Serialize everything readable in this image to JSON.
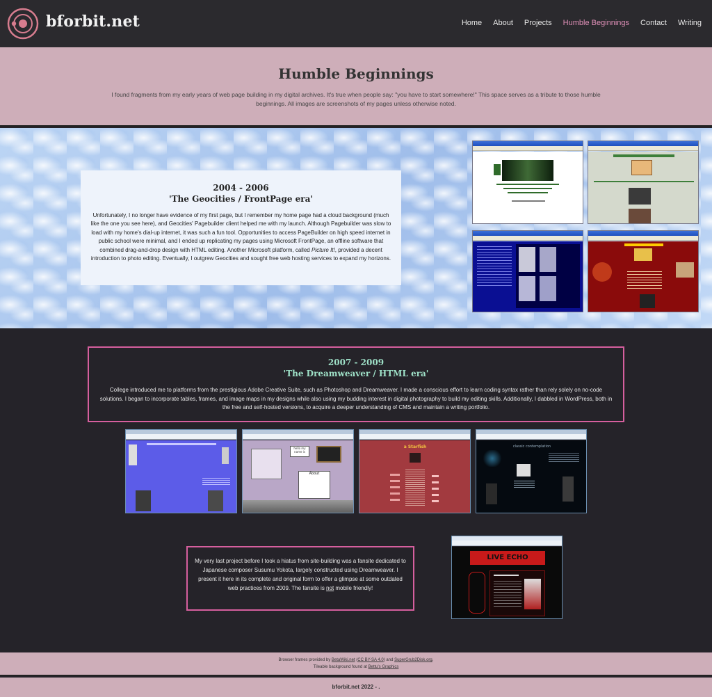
{
  "site": {
    "logo_text": "bforbit.net"
  },
  "nav": {
    "items": [
      {
        "label": "Home"
      },
      {
        "label": "About"
      },
      {
        "label": "Projects"
      },
      {
        "label": "Humble Beginnings",
        "active": true
      },
      {
        "label": "Contact"
      },
      {
        "label": "Writing"
      }
    ]
  },
  "intro": {
    "title": "Humble Beginnings",
    "text": "I found fragments from my early years of web page building in my digital archives. It's true when people say: \"you have to start somewhere!\" This space serves as a tribute to those humble beginnings. All images are screenshots of my pages unless otherwise noted."
  },
  "era1": {
    "years": "2004 - 2006",
    "subtitle": "'The Geocities / FrontPage era'",
    "text_before": "Unfortunately, I no longer have evidence of my first page, but I remember my home page had a cloud background (much like the one you see here), and Geocities' Pagebuilder client helped me with my launch. Although Pagebuilder was slow to load with my home's dial-up internet, it was such a fun tool. Opportunities to access PageBuilder on high speed internet in public school were minimal, and I ended up replicating my pages using Microsoft FrontPage, an offline software that combined drag-and-drop design with HTML editing. Another Microsoft platform, called ",
    "text_em": "Picture It!",
    "text_after": ", provided a decent introduction to photo editing. Eventually, I outgrew Geocities and sought free web hosting services to expand my horizons.",
    "screens": [
      {
        "heading": "Anthony Hopkins",
        "bg": "#ffffff",
        "accent": "#2f6b2a"
      },
      {
        "heading": "Anthony Hopkins as \"The Critic\"",
        "bg": "#d4d9cc",
        "accent": "#3d7f3a"
      },
      {
        "heading": "",
        "bg": "#0a0f93",
        "accent": "#e4e4ff"
      },
      {
        "heading": "A Vessel Special",
        "bg": "#8a0b0b",
        "accent": "#ffcc00"
      }
    ]
  },
  "era2": {
    "years": "2007 - 2009",
    "subtitle": "'The Dreamweaver / HTML era'",
    "text": "College introduced me to platforms from the prestigious Adobe Creative Suite, such as Photoshop and Dreamweaver. I made a conscious effort to learn coding syntax rather than rely solely on no-code solutions. I began to incorporate tables, frames, and image maps in my designs while also using my budding interest in digital photography to build my editing skills. Additionally, I dabbled in WordPress, both in the free and self-hosted versions, to acquire a deeper understanding of CMS and maintain a writing portfolio.",
    "screens": [
      {
        "bg": "#5c5ce8"
      },
      {
        "bg": "#b9a7c7",
        "label_hello": "hello my name is",
        "label_about": "About"
      },
      {
        "bg": "#a23a3f",
        "label_title": "a Starfish"
      },
      {
        "bg": "#050a10",
        "label_title": "classic contemplation"
      }
    ]
  },
  "fansite": {
    "text_before": "My very last project before I took a hiatus from site-building was a fansite dedicated to Japanese composer Susumu Yokota, largely constructed using Dreamweaver. I present it here in its complete and original form to offer a glimpse at some outdated web practices from 2009. The fansite is ",
    "text_u": "not",
    "text_after": " mobile friendly!",
    "screen": {
      "banner": "LIVE ECHO",
      "bg": "#0a0a0a",
      "accent": "#c81a1a"
    }
  },
  "footer": {
    "credits_1_a": "Browser frames provided by ",
    "link_betawiki": "BetaWiki.net",
    "credits_1_b": " (",
    "link_license": "CC BY-SA 4.0",
    "credits_1_c": ") and ",
    "link_supergrub": "SuperGrub2Disk.org",
    "credits_1_d": ".",
    "credits_2_a": "Tileable background found at ",
    "link_bettu": "Bettu's Graphics",
    "copyright": "bforbit.net 2022 - ."
  }
}
